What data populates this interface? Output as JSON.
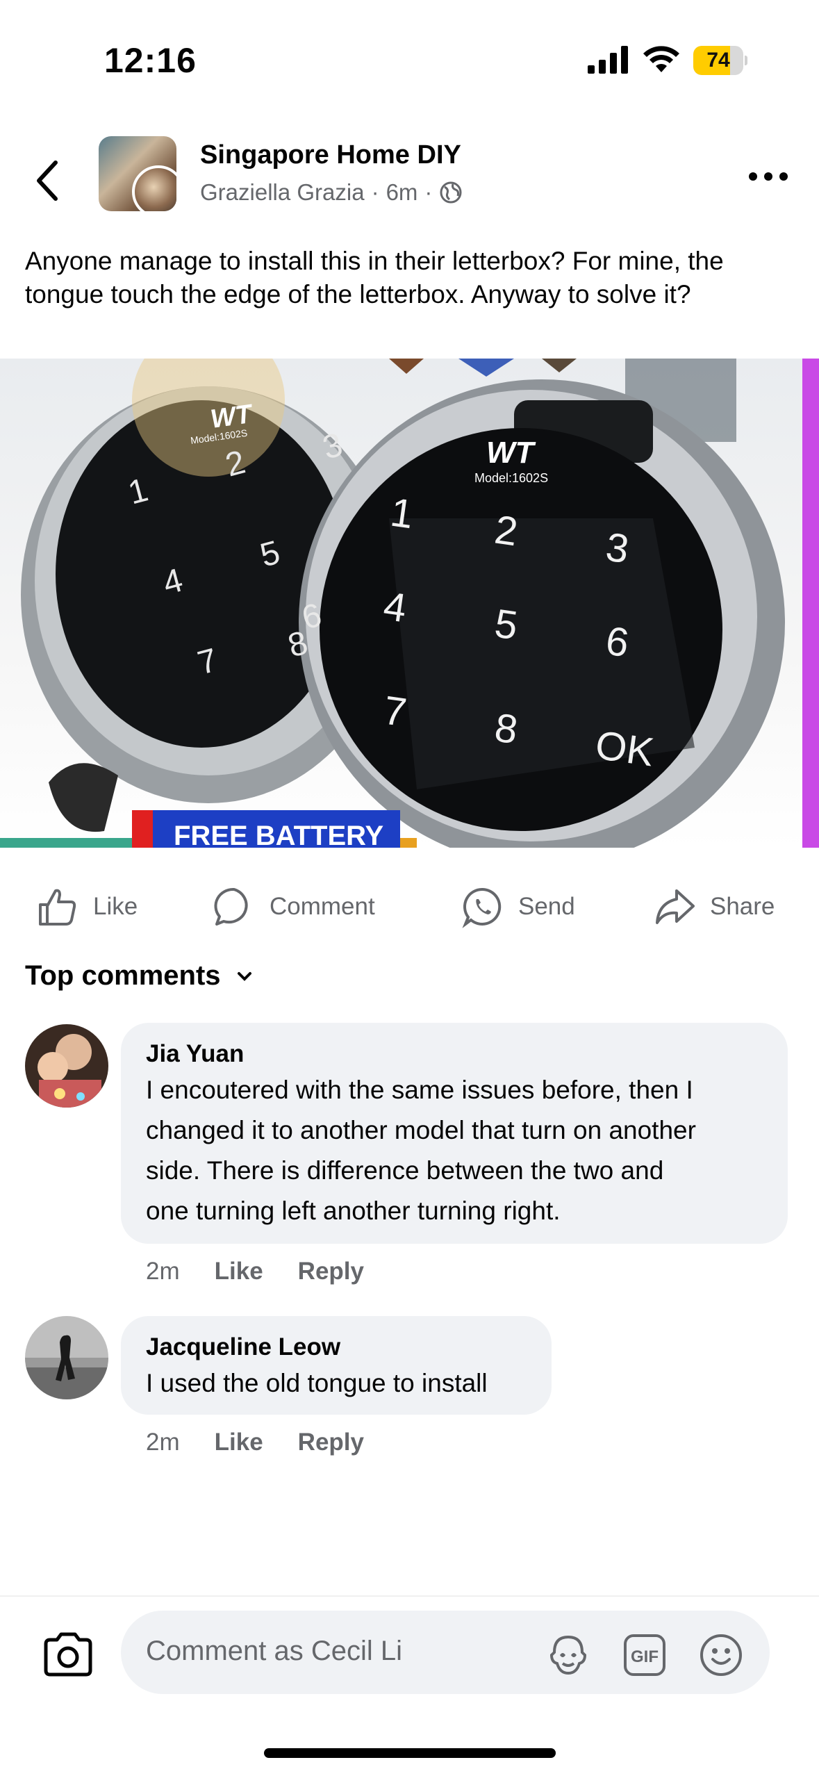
{
  "status_bar": {
    "time": "12:16",
    "battery": "74",
    "battery_level": 0.74
  },
  "header": {
    "group_name": "Singapore Home DIY",
    "author": "Graziella Grazia",
    "separator": "·",
    "time_ago": "6m",
    "back_icon": "chevron-left-icon",
    "more_icon": "more-horizontal-icon",
    "privacy_icon": "globe-icon"
  },
  "post": {
    "text": "Anyone manage to install this in their letterbox? For mine, the tongue touch the edge of the letterbox. Anyway to solve it?",
    "image": {
      "brand": "WT",
      "model": "Model:1602S",
      "keys": [
        "1",
        "2",
        "3",
        "4",
        "5",
        "6",
        "7",
        "8",
        "OK"
      ],
      "banner": "FREE BATTERY"
    }
  },
  "actions": {
    "like": "Like",
    "comment": "Comment",
    "send": "Send",
    "share": "Share"
  },
  "comments_section": {
    "title": "Top comments"
  },
  "comments": [
    {
      "name": "Jia Yuan",
      "lines": [
        "I encoutered with the same issues before, then I",
        "changed it to another model that turn on another",
        "side. There is difference between the two and",
        "one turning left another turning right."
      ],
      "time": "2m",
      "like": "Like",
      "reply": "Reply"
    },
    {
      "name": "Jacqueline Leow",
      "lines": [
        "I used the old tongue to install"
      ],
      "time": "2m",
      "like": "Like",
      "reply": "Reply"
    }
  ],
  "composer": {
    "placeholder": "Comment as Cecil Li",
    "icons": [
      "camera-icon",
      "avatar-sticker-icon",
      "gif-icon",
      "emoji-icon"
    ]
  },
  "colors": {
    "secondary_text": "#65676b",
    "bubble_bg": "#f0f2f5",
    "battery": "#ffcc00"
  }
}
